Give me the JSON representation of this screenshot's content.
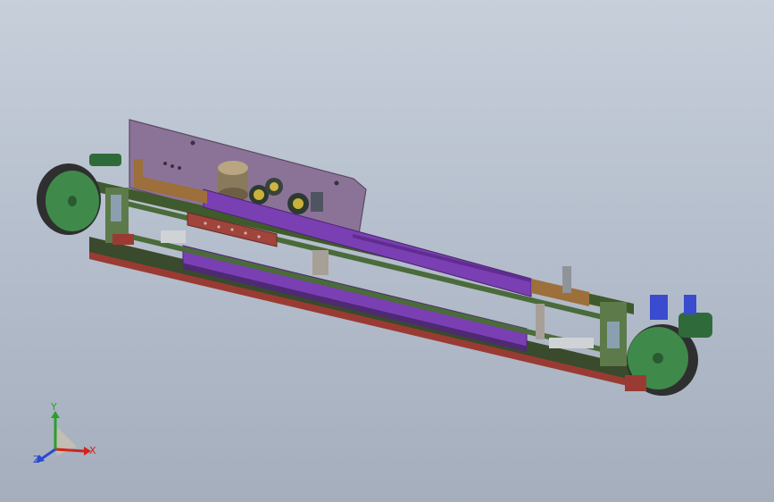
{
  "viewport": {
    "background_top": "#c7cfdb",
    "background_bottom": "#a5aebd"
  },
  "model": {
    "name": "conveyor-assembly",
    "colors": {
      "back_plate": "#8b7397",
      "frame_green": "#3f5a2c",
      "rail_purple": "#7b3fb4",
      "wood_strip": "#9c6f3b",
      "pulley_green": "#3f8a4a",
      "pulley_dark": "#2f2f2f",
      "motor_blue": "#3a4bd0",
      "red_bar": "#9a3b33",
      "steel": "#8f949a"
    }
  },
  "triad": {
    "x_label": "X",
    "y_label": "Y",
    "z_label": "Z",
    "x_color": "#d0241c",
    "y_color": "#2aa02a",
    "z_color": "#2a4ad0"
  }
}
